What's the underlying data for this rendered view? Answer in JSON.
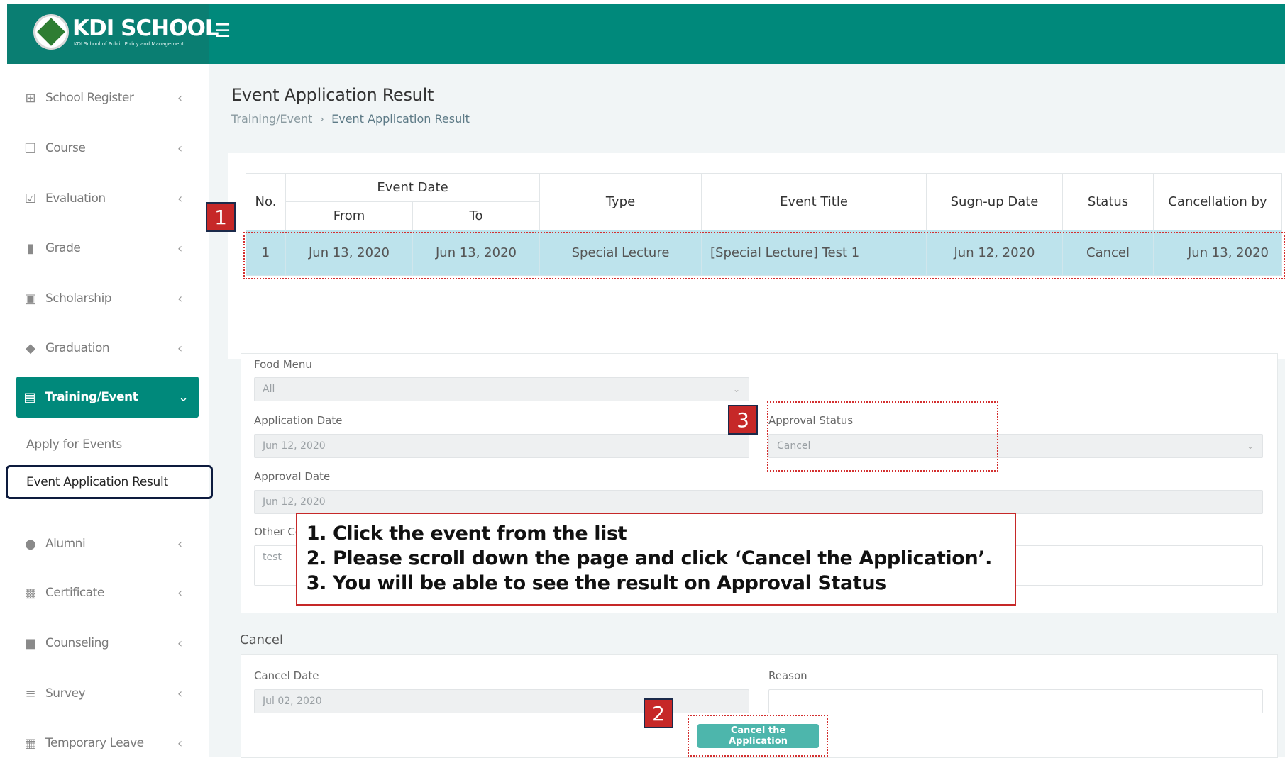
{
  "brand": {
    "name": "KDI SCHOOL",
    "subtitle": "KDI School of Public Policy and Management"
  },
  "sidebar": {
    "items": [
      {
        "label": "School Register",
        "icon": "grid-icon"
      },
      {
        "label": "Course",
        "icon": "copy-icon"
      },
      {
        "label": "Evaluation",
        "icon": "checkbox-icon"
      },
      {
        "label": "Grade",
        "icon": "bar-chart-icon"
      },
      {
        "label": "Scholarship",
        "icon": "book-icon"
      },
      {
        "label": "Graduation",
        "icon": "graduation-cap-icon"
      },
      {
        "label": "Training/Event",
        "icon": "presentation-icon"
      },
      {
        "label": "Alumni",
        "icon": "people-icon"
      },
      {
        "label": "Certificate",
        "icon": "certificate-icon"
      },
      {
        "label": "Counseling",
        "icon": "coffee-icon"
      },
      {
        "label": "Survey",
        "icon": "list-check-icon"
      },
      {
        "label": "Temporary Leave",
        "icon": "calendar-icon"
      }
    ],
    "sub_items": [
      "Apply for Events",
      "Event Application Result"
    ]
  },
  "page": {
    "title": "Event Application Result",
    "breadcrumb": [
      "Training/Event",
      "Event Application Result"
    ]
  },
  "table": {
    "headers": {
      "no": "No.",
      "event_date": "Event Date",
      "from": "From",
      "to": "To",
      "type": "Type",
      "event_title": "Event Title",
      "signup_date": "Sugn-up Date",
      "status": "Status",
      "cancellation_by": "Cancellation by"
    },
    "rows": [
      {
        "no": "1",
        "from": "Jun 13, 2020",
        "to": "Jun 13, 2020",
        "type": "Special Lecture",
        "event_title": "[Special Lecture] Test 1",
        "signup_date": "Jun 12, 2020",
        "status": "Cancel",
        "cancellation_by": "Jun 13, 2020"
      }
    ]
  },
  "form": {
    "food_menu_label": "Food Menu",
    "food_menu_value": "All",
    "application_date_label": "Application Date",
    "application_date_value": "Jun 12, 2020",
    "approval_status_label": "Approval Status",
    "approval_status_value": "Cancel",
    "approval_date_label": "Approval Date",
    "approval_date_value": "Jun 12, 2020",
    "other_label": "Other Co",
    "other_value": "test"
  },
  "cancel_section": {
    "title": "Cancel",
    "cancel_date_label": "Cancel Date",
    "cancel_date_value": "Jul 02, 2020",
    "reason_label": "Reason",
    "reason_value": "",
    "button_label": "Cancel the Application"
  },
  "instructions": [
    "Click the event from the list",
    "Please scroll down the page and click ‘Cancel the Application’.",
    "You will be able to see the result on Approval Status"
  ],
  "markers": [
    "1",
    "2",
    "3"
  ],
  "colors": {
    "brand": "#00897b",
    "selected_row": "#bde3ec",
    "annotation_red": "#c62828",
    "button": "#4db6ac"
  }
}
